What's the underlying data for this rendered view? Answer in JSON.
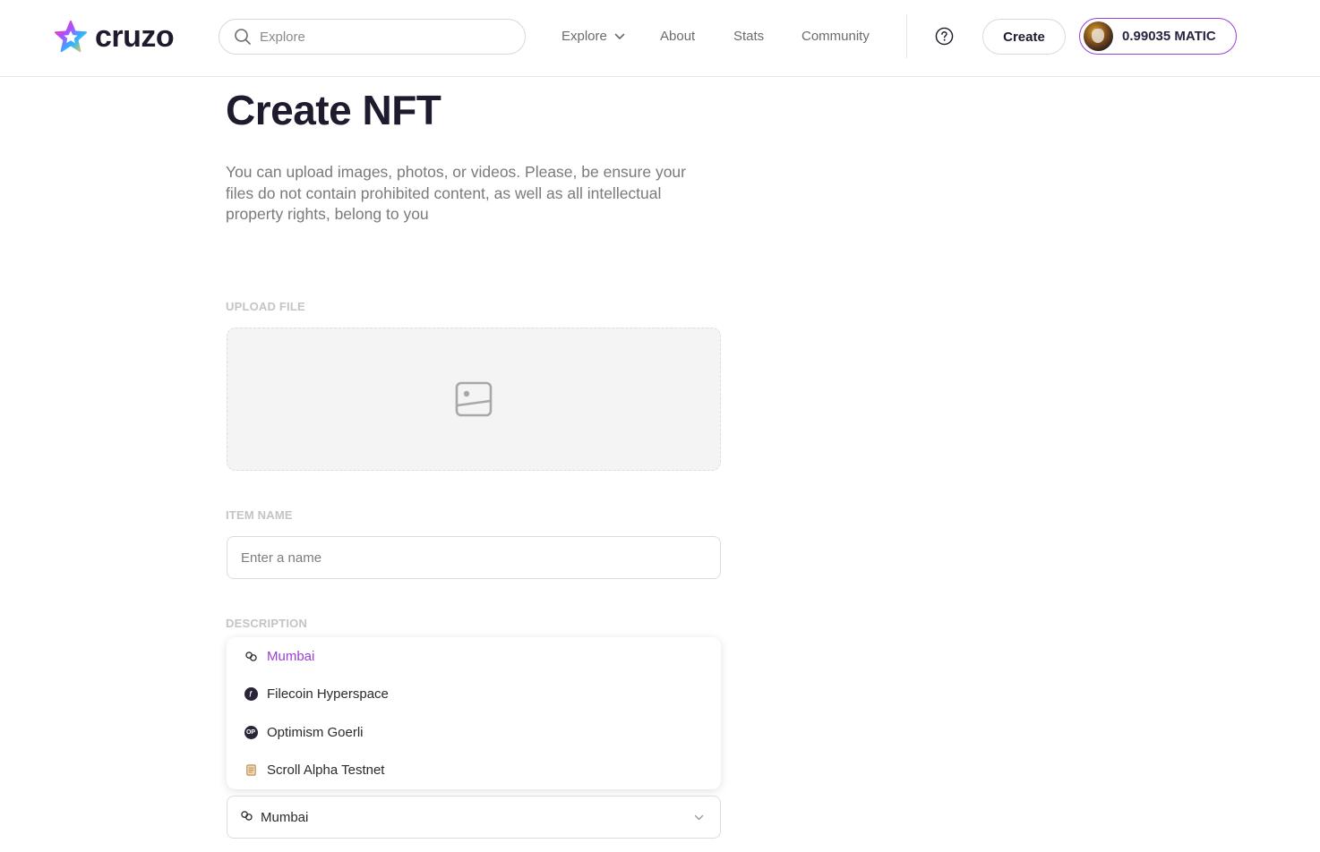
{
  "header": {
    "logo_text": "cruzo",
    "search": {
      "placeholder": "Explore"
    },
    "nav": {
      "explore": "Explore",
      "about": "About",
      "stats": "Stats",
      "community": "Community"
    },
    "create_label": "Create",
    "wallet_balance": "0.99035 MATIC"
  },
  "main": {
    "title": "Create NFT",
    "description": "You can upload images, photos, or videos. Please, be ensure your files do not contain prohibited content, as well as all intellectual property rights, belong to you",
    "upload_label": "UPLOAD FILE",
    "item_name_label": "ITEM NAME",
    "item_name_placeholder": "Enter a name",
    "description_label": "DESCRIPTION",
    "network_dropdown": {
      "options": [
        {
          "label": "Mumbai",
          "icon": "chain-link-icon",
          "selected": true
        },
        {
          "label": "Filecoin Hyperspace",
          "icon": "filecoin-icon",
          "selected": false
        },
        {
          "label": "Optimism Goerli",
          "icon": "optimism-icon",
          "selected": false
        },
        {
          "label": "Scroll Alpha Testnet",
          "icon": "scroll-icon",
          "selected": false
        }
      ],
      "selected_value": "Mumbai"
    }
  },
  "colors": {
    "accent": "#9b3fd6",
    "text_dark": "#1f1a2e",
    "label_muted": "#c4c4c4"
  }
}
